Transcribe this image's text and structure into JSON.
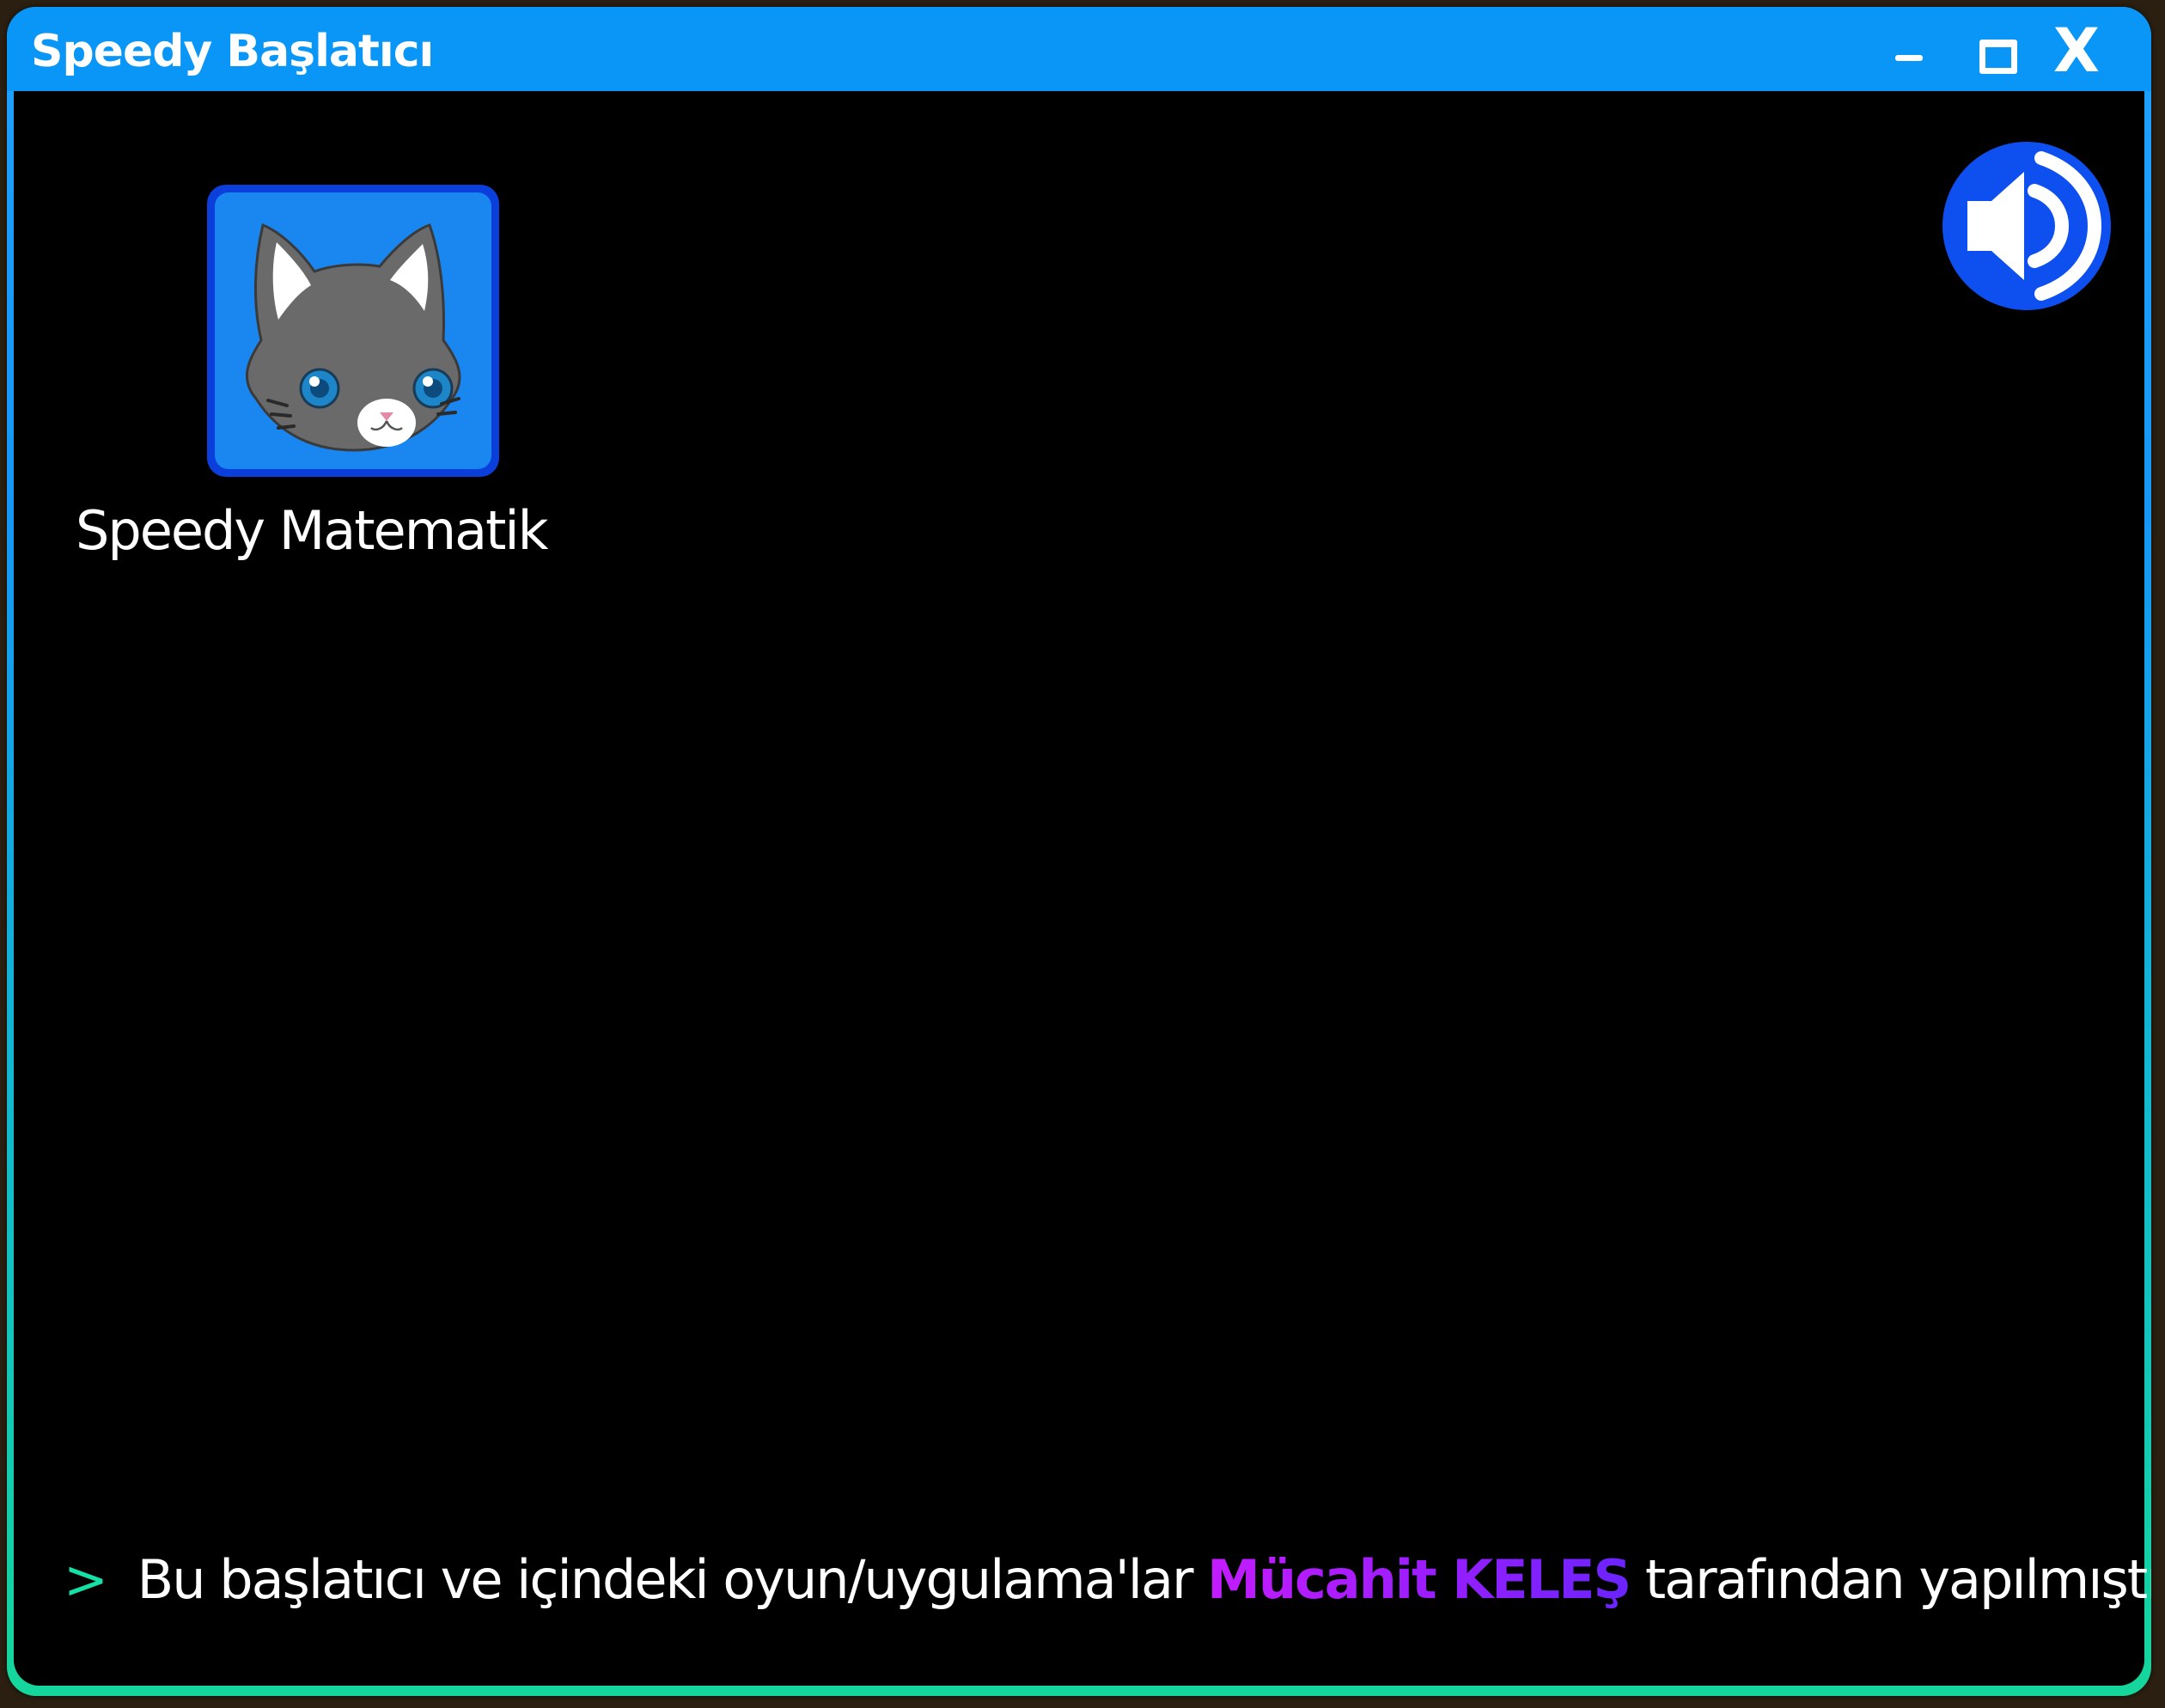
{
  "window": {
    "title": "Speedy Başlatıcı",
    "controls": {
      "minimize_icon": "minimize-icon",
      "maximize_icon": "maximize-icon",
      "close_label": "X"
    }
  },
  "apps": [
    {
      "label": "Speedy Matematik",
      "icon": "cat-face-icon",
      "tile_color": "#1a86f0"
    }
  ],
  "sound": {
    "icon": "speaker-icon",
    "color": "#0e4ff0"
  },
  "footer": {
    "prompt": ">",
    "text_before": "Bu başlatıcı ve içindeki oyun/uygulama'lar",
    "author": "Mücahit KELEŞ",
    "text_after": "tarafından yapılmıştır."
  },
  "colors": {
    "titlebar": "#0a96f6",
    "background": "#000000",
    "prompt": "#15e0a6",
    "author_gradient": [
      "#c31cff",
      "#6a24ff"
    ]
  }
}
